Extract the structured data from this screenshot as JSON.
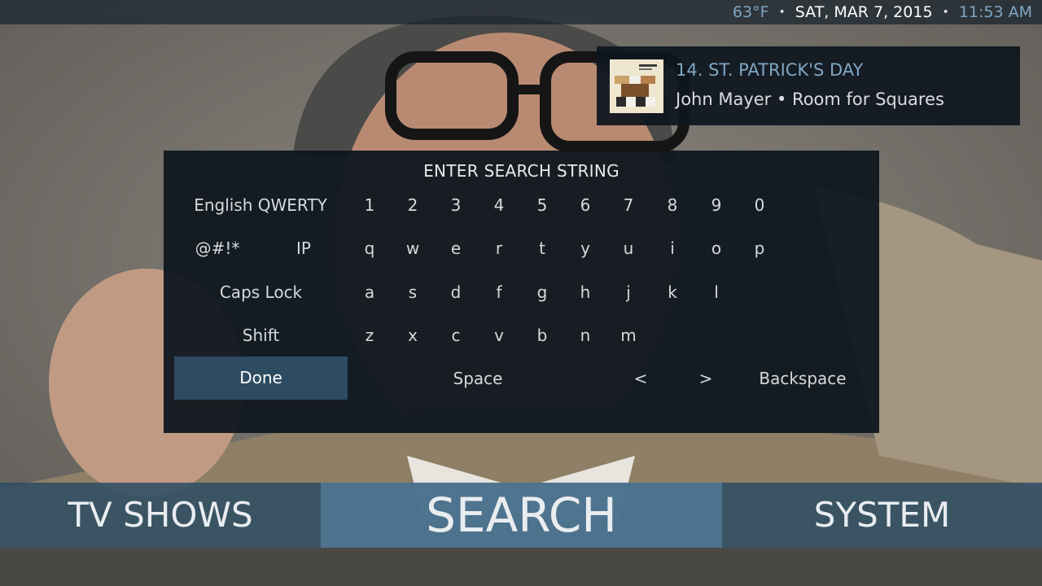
{
  "status_bar": {
    "temperature": "63°F",
    "separator": "•",
    "date": "SAT, MAR 7, 2015",
    "time": "11:53 AM"
  },
  "now_playing": {
    "title": "14. ST. PATRICK'S DAY",
    "subtitle": "John Mayer • Room for Squares"
  },
  "keyboard": {
    "title": "ENTER SEARCH STRING",
    "layout_label": "English QWERTY",
    "symbols_label": "@#!*",
    "ip_label": "IP",
    "caps_label": "Caps Lock",
    "shift_label": "Shift",
    "done_label": "Done",
    "space_label": "Space",
    "left_label": "<",
    "right_label": ">",
    "backspace_label": "Backspace",
    "rows": [
      [
        "1",
        "2",
        "3",
        "4",
        "5",
        "6",
        "7",
        "8",
        "9",
        "0"
      ],
      [
        "q",
        "w",
        "e",
        "r",
        "t",
        "y",
        "u",
        "i",
        "o",
        "p"
      ],
      [
        "a",
        "s",
        "d",
        "f",
        "g",
        "h",
        "j",
        "k",
        "l"
      ],
      [
        "z",
        "x",
        "c",
        "v",
        "b",
        "n",
        "m"
      ]
    ]
  },
  "menu": {
    "items": [
      {
        "label": "TV SHOWS"
      },
      {
        "label": "SEARCH"
      },
      {
        "label": "SYSTEM"
      }
    ],
    "selected": "SEARCH"
  },
  "colors": {
    "accent": "#7fa6c4",
    "dialog_bg": "#0e161e",
    "focus": "#2d4b61",
    "menu_bar": "#2c4c64",
    "menu_selected": "#50769a"
  }
}
